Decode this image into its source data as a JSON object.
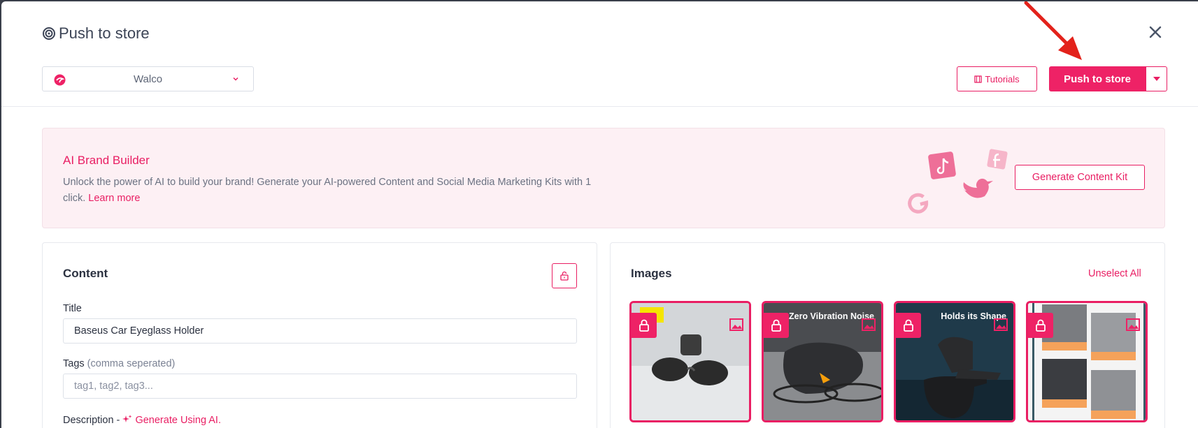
{
  "modal": {
    "title": "Push to store",
    "store_select": {
      "value": "Walco"
    },
    "tutorials_label": "Tutorials",
    "push_label": "Push to store"
  },
  "banner": {
    "title": "AI Brand Builder",
    "text": "Unlock the power of AI to build your brand! Generate your AI-powered Content and Social Media Marketing Kits with 1 click.",
    "learn_more": "Learn more",
    "button_label": "Generate Content Kit"
  },
  "content_card": {
    "title": "Content",
    "title_label": "Title",
    "title_value": "Baseus Car Eyeglass Holder",
    "tags_label": "Tags",
    "tags_hint": "(comma seperated)",
    "tags_placeholder": "tag1, tag2, tag3...",
    "description_label": "Description -",
    "generate_label": "Generate Using AI."
  },
  "images_card": {
    "title": "Images",
    "unselect_label": "Unselect All",
    "thumbs": [
      {
        "caption": ""
      },
      {
        "caption": "Zero Vibration Noise"
      },
      {
        "caption": "Holds its Shape"
      },
      {
        "caption": ""
      }
    ]
  },
  "colors": {
    "accent": "#e91e63",
    "banner_bg": "#fdf0f4",
    "title_text": "#3c4456"
  },
  "icons": [
    "target-icon",
    "close-icon",
    "store-logo-icon",
    "chevron-down-icon",
    "film-icon",
    "caret-down-icon",
    "tiktok-icon",
    "facebook-icon",
    "google-icon",
    "twitter-icon",
    "unlock-icon",
    "lock-icon",
    "image-icon",
    "sparkle-icon"
  ]
}
